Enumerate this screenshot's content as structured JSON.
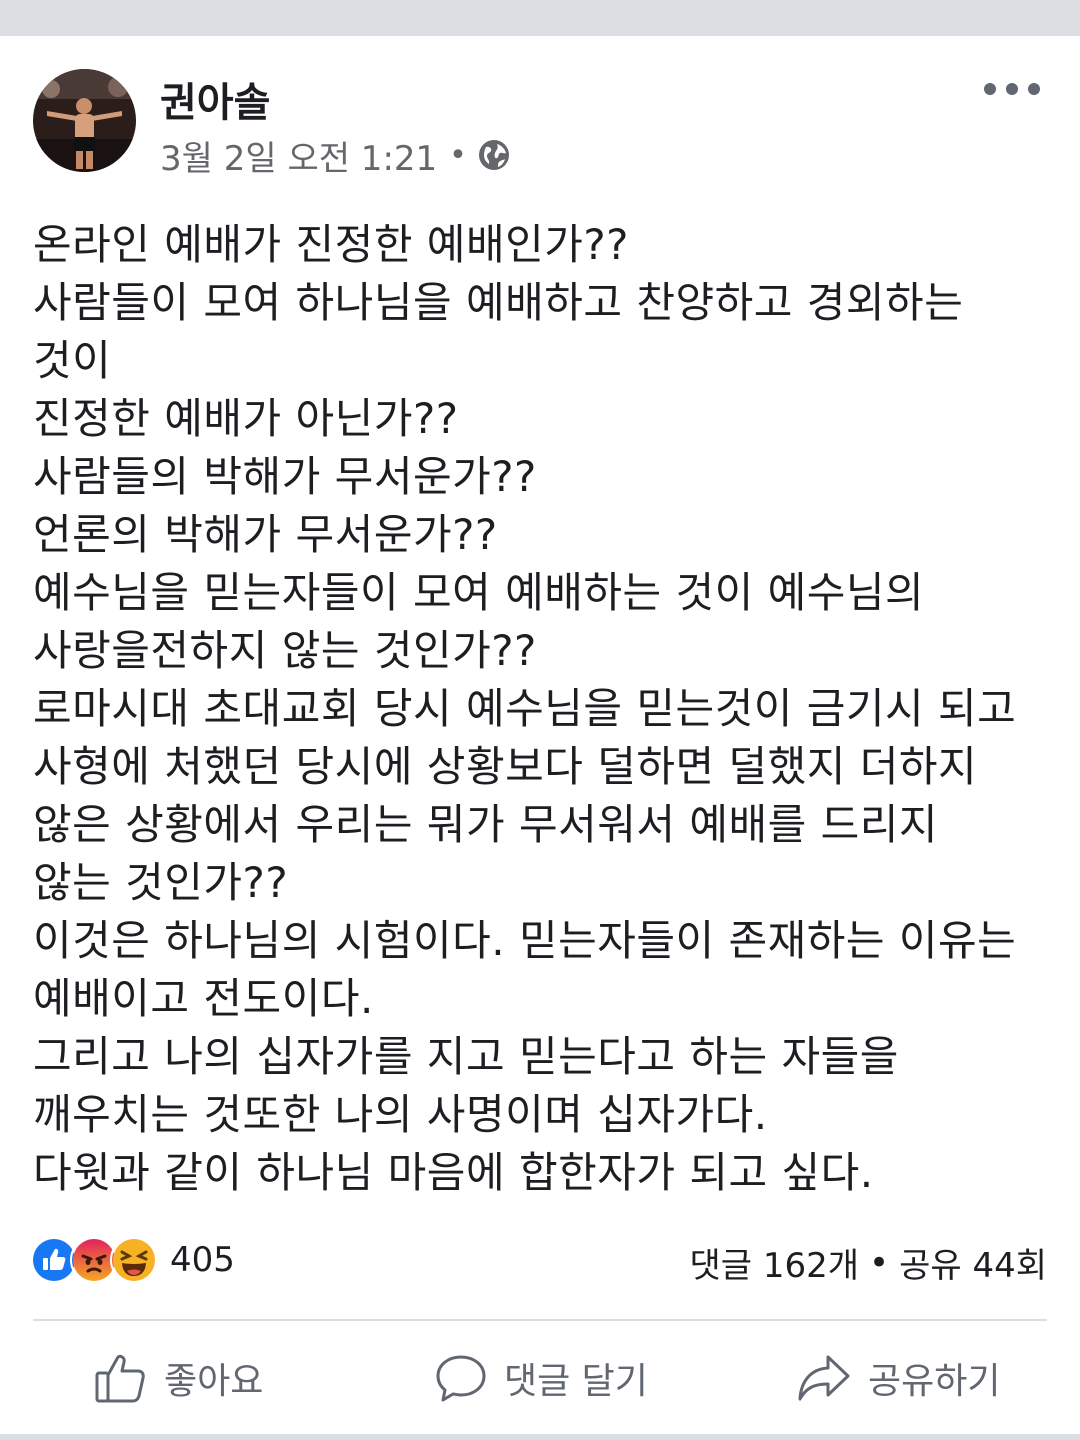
{
  "post": {
    "author": "권아솔",
    "timestamp": "3월 2일 오전 1:21",
    "meta_separator": "•",
    "privacy_icon": "globe-icon",
    "more_icon": "more-horizontal-icon",
    "lines": [
      "온라인 예배가 진정한 예배인가??",
      "사람들이 모여 하나님을 예배하고 찬양하고 경외하는",
      "것이",
      "진정한 예배가 아닌가??",
      "사람들의 박해가 무서운가??",
      "언론의 박해가 무서운가??",
      "예수님을 믿는자들이 모여 예배하는 것이 예수님의",
      "사랑을전하지 않는 것인가??",
      "로마시대 초대교회 당시 예수님을 믿는것이 금기시 되고",
      "사형에 처했던 당시에 상황보다 덜하면 덜했지 더하지",
      "않은 상황에서 우리는 뭐가 무서워서 예배를 드리지",
      "않는 것인가??",
      "이것은 하나님의 시험이다. 믿는자들이 존재하는 이유는",
      "예배이고 전도이다.",
      "그리고 나의 십자가를 지고 믿는다고 하는 자들을",
      "깨우치는 것또한 나의 사명이며 십자가다.",
      "다윗과 같이 하나님 마음에 합한자가 되고 싶다."
    ]
  },
  "reactions": {
    "icons": [
      "like-reaction-icon",
      "angry-reaction-icon",
      "haha-reaction-icon"
    ],
    "count": "405"
  },
  "stats": {
    "comments": "댓글 162개",
    "separator": "•",
    "shares": "공유 44회"
  },
  "actions": {
    "like": "좋아요",
    "comment": "댓글 달기",
    "share": "공유하기"
  },
  "colors": {
    "like_blue": "#1877f2",
    "angry": "#e9710f",
    "haha": "#f7b125",
    "secondary_text": "#65676b"
  }
}
